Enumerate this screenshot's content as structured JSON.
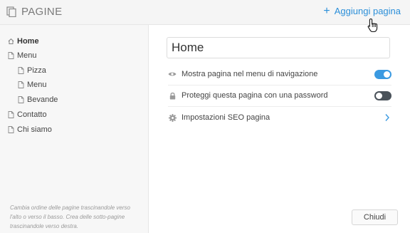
{
  "header": {
    "title": "PAGINE",
    "title_icon": "pages-icon",
    "add_label": "Aggiungi pagina",
    "add_icon": "plus-icon"
  },
  "sidebar": {
    "items": [
      {
        "label": "Home",
        "icon": "home-icon",
        "active": true
      },
      {
        "label": "Menu",
        "icon": "page-icon"
      },
      {
        "label": "Pizza",
        "icon": "page-icon"
      },
      {
        "label": "Menu",
        "icon": "page-icon"
      },
      {
        "label": "Bevande",
        "icon": "page-icon"
      },
      {
        "label": "Contatto",
        "icon": "page-icon"
      },
      {
        "label": "Chi siamo",
        "icon": "page-icon"
      }
    ],
    "hint": "Cambia ordine delle pagine trascinandole verso l'alto o verso il basso. Crea delle sotto-pagine trascinandole verso destra."
  },
  "main": {
    "page_name": "Home",
    "settings": [
      {
        "label": "Mostra pagina nel menu di navigazione",
        "icon": "eye-icon",
        "control": "toggle",
        "on": true
      },
      {
        "label": "Proteggi questa pagina con una password",
        "icon": "lock-icon",
        "control": "toggle",
        "on": false
      },
      {
        "label": "Impostazioni SEO pagina",
        "icon": "gear-icon",
        "control": "chevron"
      }
    ],
    "close_label": "Chiudi"
  },
  "colors": {
    "accent": "#2b8fd9",
    "toggle_on": "#3b9ae1",
    "toggle_off": "#4a525a"
  }
}
